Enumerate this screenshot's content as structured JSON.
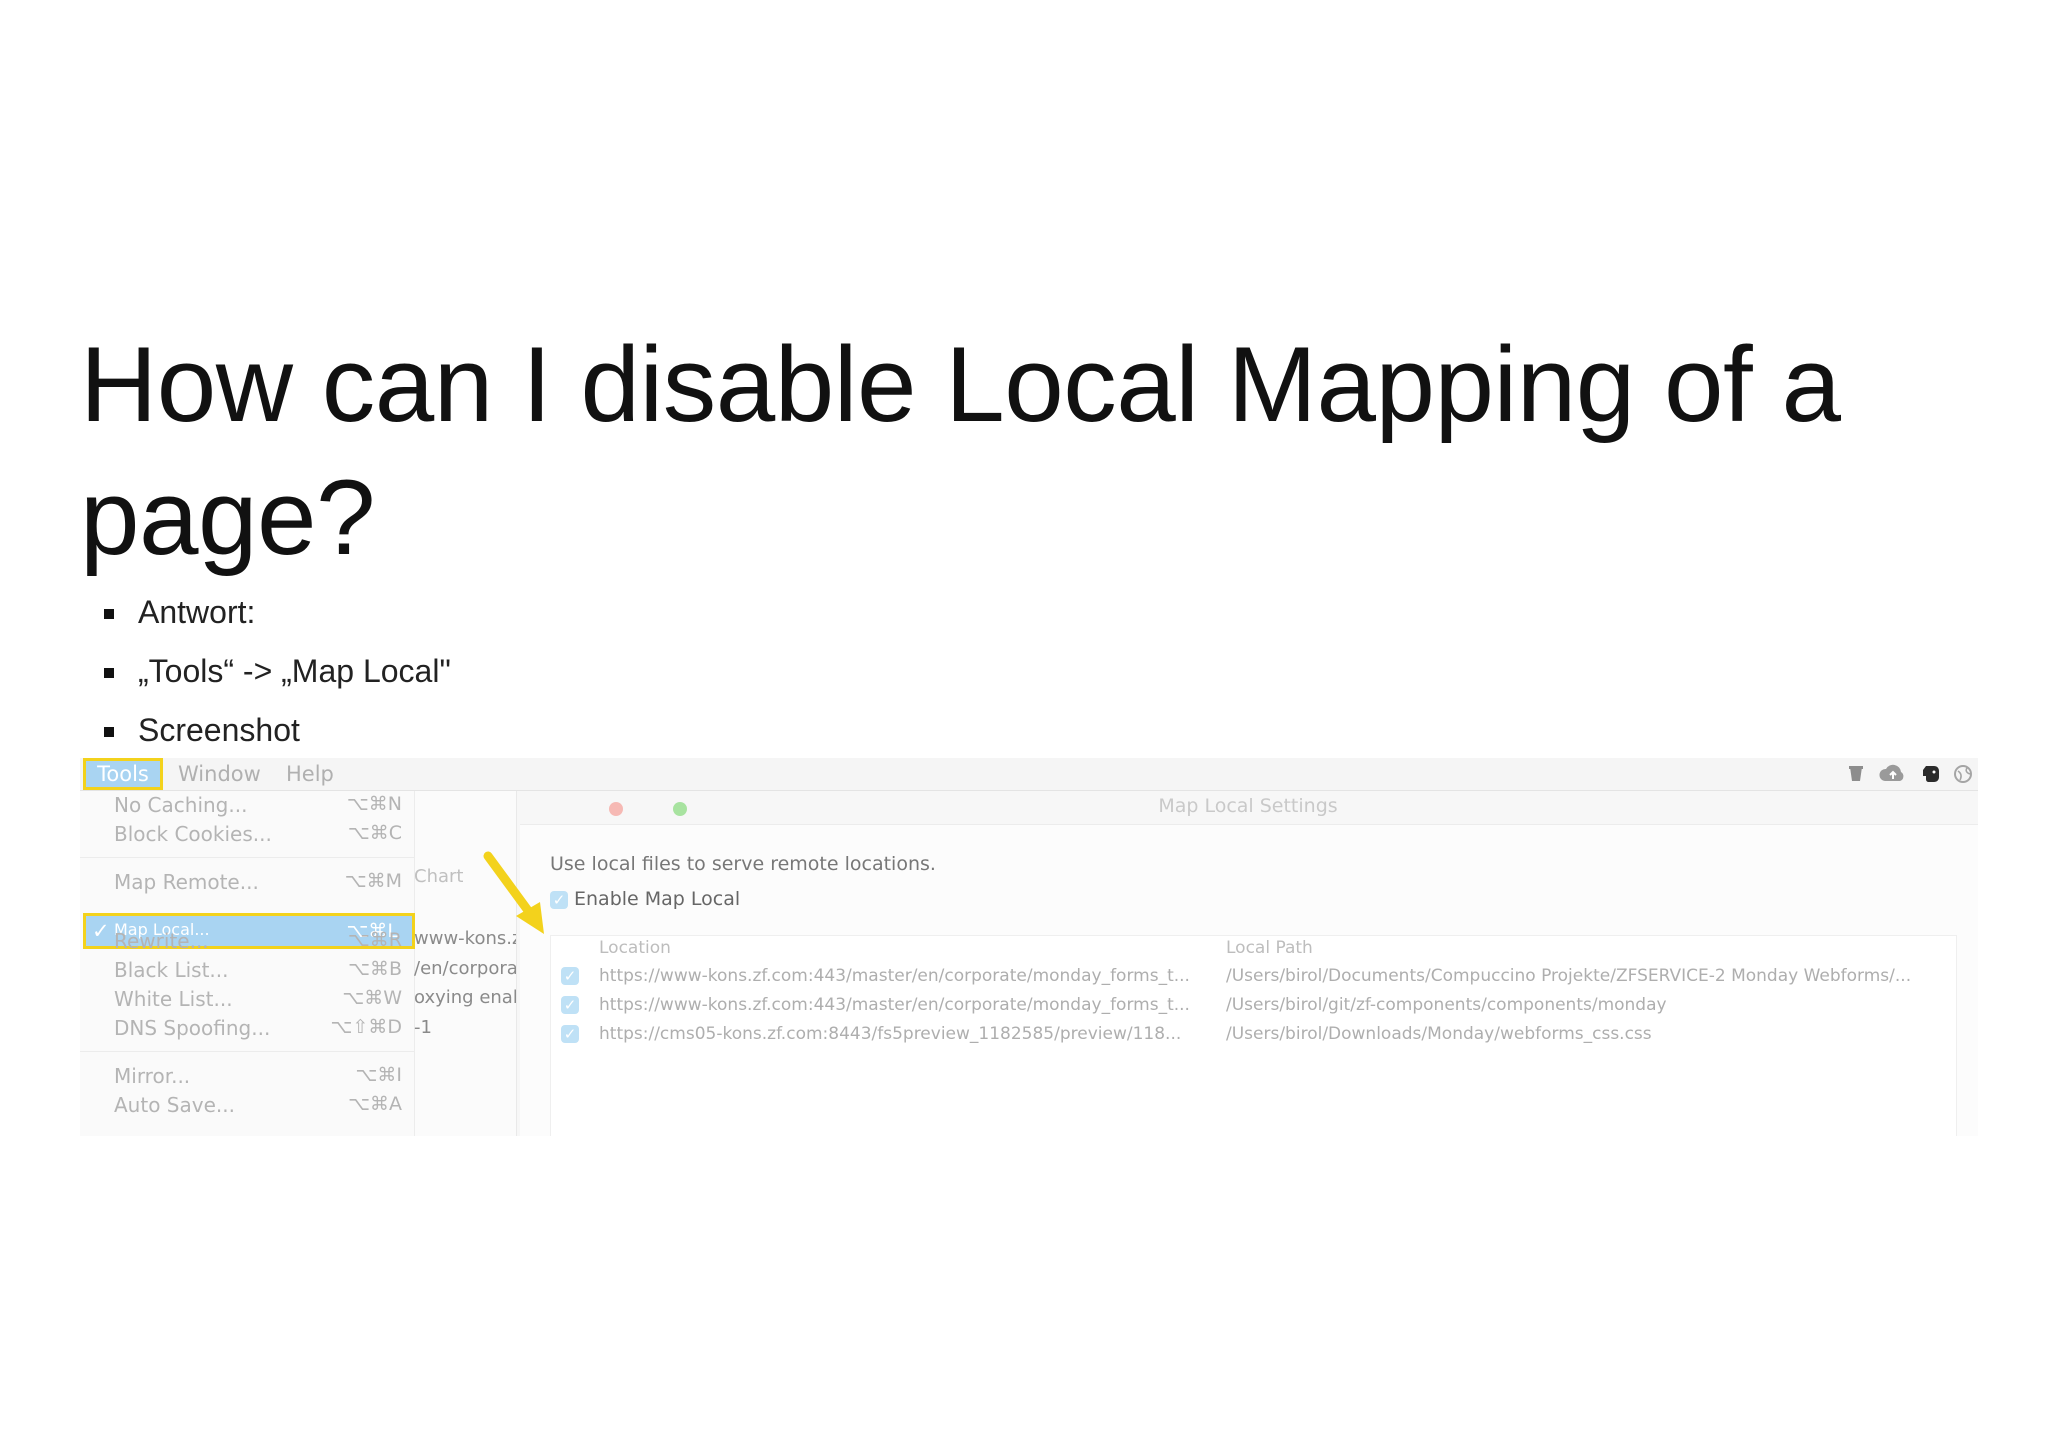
{
  "title": "How can I disable Local Mapping of a page?",
  "bullets": [
    "Antwort:",
    "„Tools“ -> „Map Local\"",
    "Screenshot"
  ],
  "screenshot": {
    "menubar": {
      "tools": "Tools",
      "window": "Window",
      "help": "Help",
      "tray_icons": [
        "jug-icon",
        "cloud-upload-icon",
        "evernote-elephant-icon",
        "globe-icon"
      ]
    },
    "tools_menu": {
      "items": [
        {
          "label": "No Caching...",
          "shortcut": "⌥⌘N"
        },
        {
          "label": "Block Cookies...",
          "shortcut": "⌥⌘C"
        },
        {
          "label": "Map Remote...",
          "shortcut": "⌥⌘M"
        },
        {
          "label": "Map Local...",
          "shortcut": "⌥⌘L",
          "checked": true
        },
        {
          "label": "Rewrite...",
          "shortcut": "⌥⌘R"
        },
        {
          "label": "Black List...",
          "shortcut": "⌥⌘B"
        },
        {
          "label": "White List...",
          "shortcut": "⌥⌘W"
        },
        {
          "label": "DNS Spoofing...",
          "shortcut": "⌥⇧⌘D"
        },
        {
          "label": "Mirror...",
          "shortcut": "⌥⌘I"
        },
        {
          "label": "Auto Save...",
          "shortcut": "⌥⌘A"
        }
      ]
    },
    "background_fragments": [
      "Chart",
      "www-kons.z",
      "/en/corpora",
      "oxying enabl",
      "-1"
    ],
    "dialog": {
      "title": "Map Local Settings",
      "description": "Use local files to serve remote locations.",
      "enable_label": "Enable Map Local",
      "enabled": true,
      "columns": {
        "location": "Location",
        "local_path": "Local Path"
      },
      "rows": [
        {
          "checked": true,
          "location": "https://www-kons.zf.com:443/master/en/corporate/monday_forms_t...",
          "local_path": "/Users/birol/Documents/Compuccino Projekte/ZFSERVICE-2 Monday Webforms/..."
        },
        {
          "checked": true,
          "location": "https://www-kons.zf.com:443/master/en/corporate/monday_forms_t...",
          "local_path": "/Users/birol/git/zf-components/components/monday"
        },
        {
          "checked": true,
          "location": "https://cms05-kons.zf.com:8443/fs5preview_1182585/preview/118...",
          "local_path": "/Users/birol/Downloads/Monday/webforms_css.css"
        }
      ]
    },
    "colors": {
      "highlight_border": "#f3d21c",
      "selection_blue": "#a9d4f2",
      "arrow": "#f3d21c"
    }
  }
}
